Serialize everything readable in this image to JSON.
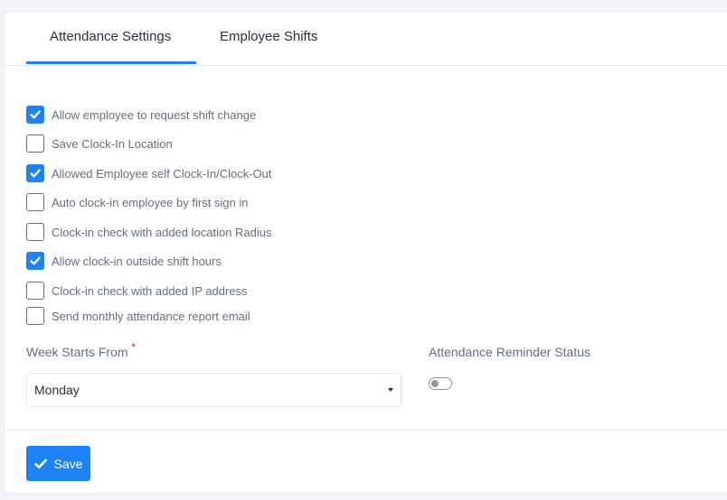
{
  "tabs": [
    {
      "label": "Attendance Settings",
      "active": true
    },
    {
      "label": "Employee Shifts",
      "active": false
    }
  ],
  "settings": [
    {
      "label": "Allow employee to request shift change",
      "checked": true
    },
    {
      "label": "Save Clock-In Location",
      "checked": false
    },
    {
      "label": "Allowed Employee self Clock-In/Clock-Out",
      "checked": true
    },
    {
      "label": "Auto clock-in employee by first sign in",
      "checked": false
    },
    {
      "label": "Clock-in check with added location Radius",
      "checked": false
    },
    {
      "label": "Allow clock-in outside shift hours",
      "checked": true
    },
    {
      "label": "Clock-in check with added IP address",
      "checked": false
    },
    {
      "label": "Send monthly attendance report email",
      "checked": false
    }
  ],
  "week_starts": {
    "label": "Week Starts From",
    "required_mark": "*",
    "value": "Monday",
    "icon": "caret-down-icon"
  },
  "reminder": {
    "label": "Attendance Reminder Status",
    "enabled": false
  },
  "footer": {
    "save_label": "Save",
    "save_icon": "check-icon"
  },
  "colors": {
    "accent": "#1d82f5",
    "text_primary": "#28313c",
    "text_secondary": "#616e80",
    "required": "#d30000"
  }
}
